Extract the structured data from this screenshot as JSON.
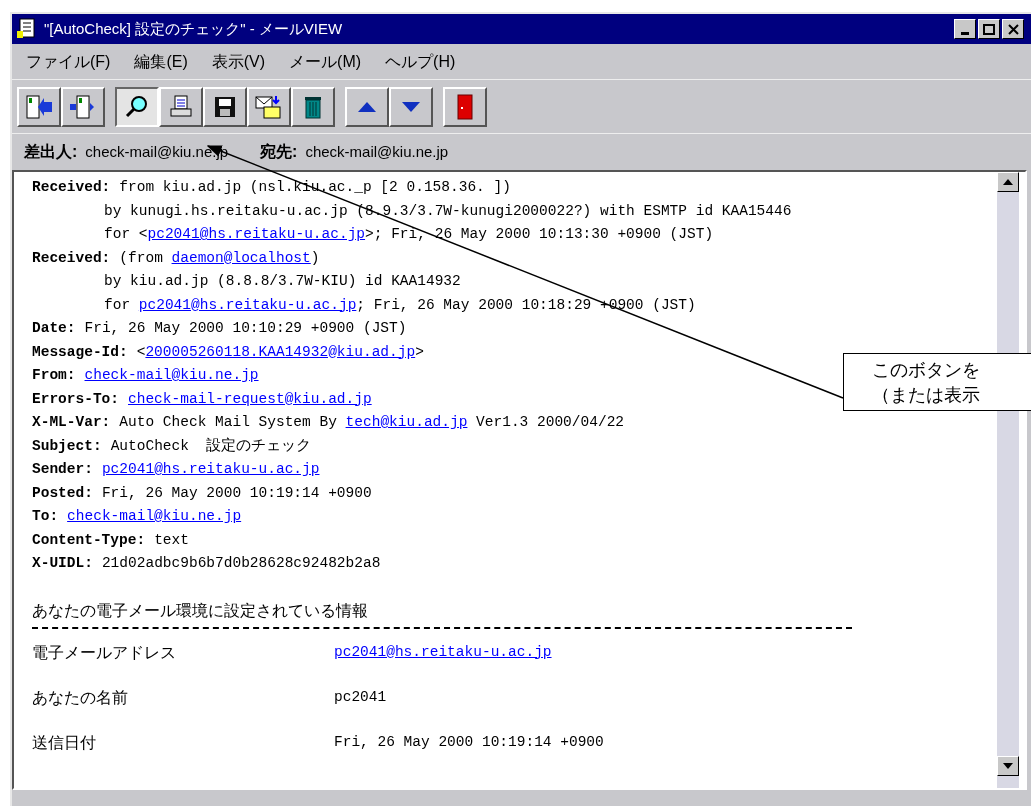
{
  "window": {
    "title": "\"[AutoCheck] 設定のチェック\" - メールVIEW"
  },
  "menu": [
    {
      "label": "ファイル(F)"
    },
    {
      "label": "編集(E)"
    },
    {
      "label": "表示(V)"
    },
    {
      "label": "メール(M)"
    },
    {
      "label": "ヘルプ(H)"
    }
  ],
  "toolbar": [
    [
      {
        "kind": "reply",
        "pressed": false
      },
      {
        "kind": "forward",
        "pressed": false
      }
    ],
    [
      {
        "kind": "search",
        "pressed": true
      },
      {
        "kind": "print",
        "pressed": false
      },
      {
        "kind": "save",
        "pressed": false
      },
      {
        "kind": "mailbox",
        "pressed": false
      },
      {
        "kind": "trash",
        "pressed": false
      }
    ],
    [
      {
        "kind": "up",
        "pressed": false
      },
      {
        "kind": "down",
        "pressed": false
      }
    ],
    [
      {
        "kind": "exit",
        "pressed": false
      }
    ]
  ],
  "address": [
    {
      "label": "差出人:",
      "value": "check-mail@kiu.ne.jp"
    },
    {
      "label": "宛先:",
      "value": "check-mail@kiu.ne.jp"
    }
  ],
  "headers": [
    {
      "label": "Received:",
      "lines": [
        [
          {
            "kind": "text",
            "text": "from kiu.ad.jp (nsl.kiu.ac._p [2 0.158.36. ])"
          }
        ],
        [
          {
            "kind": "text",
            "text": "by kunugi.hs.reitaku-u.ac.jp (8.9.3/3.7W-kunugi2000022?) with ESMTP id KAA15446"
          }
        ],
        [
          {
            "kind": "text",
            "text": "for <"
          },
          {
            "kind": "link",
            "text": "pc2041@hs.reitaku-u.ac.jp"
          },
          {
            "kind": "text",
            "text": ">; Fri, 26 May 2000 10:13:30 +0900 (JST)"
          }
        ]
      ]
    },
    {
      "label": "Received:",
      "lines": [
        [
          {
            "kind": "text",
            "text": "(from "
          },
          {
            "kind": "link",
            "text": "daemon@localhost"
          },
          {
            "kind": "text",
            "text": ")"
          }
        ],
        [
          {
            "kind": "text",
            "text": "by kiu.ad.jp (8.8.8/3.7W-KIU) id KAA14932"
          }
        ],
        [
          {
            "kind": "text",
            "text": "for "
          },
          {
            "kind": "link",
            "text": "pc2041@hs.reitaku-u.ac.jp"
          },
          {
            "kind": "text",
            "text": "; Fri, 26 May 2000 10:18:29 +0900 (JST)"
          }
        ]
      ]
    },
    {
      "label": "Date:",
      "lines": [
        [
          {
            "kind": "text",
            "text": "Fri, 26 May 2000 10:10:29 +0900 (JST)"
          }
        ]
      ]
    },
    {
      "label": "Message-Id:",
      "lines": [
        [
          {
            "kind": "text",
            "text": "<"
          },
          {
            "kind": "link",
            "text": "200005260118.KAA14932@kiu.ad.jp"
          },
          {
            "kind": "text",
            "text": ">"
          }
        ]
      ]
    },
    {
      "label": "From:",
      "lines": [
        [
          {
            "kind": "link",
            "text": "check-mail@kiu.ne.jp"
          }
        ]
      ]
    },
    {
      "label": "Errors-To:",
      "lines": [
        [
          {
            "kind": "link",
            "text": "check-mail-request@kiu.ad.jp"
          }
        ]
      ]
    },
    {
      "label": "X-ML-Var:",
      "lines": [
        [
          {
            "kind": "text",
            "text": "Auto Check Mail System By "
          },
          {
            "kind": "link",
            "text": "tech@kiu.ad.jp"
          },
          {
            "kind": "text",
            "text": " Ver1.3 2000/04/22"
          }
        ]
      ]
    },
    {
      "label": "Subject:",
      "lines": [
        [
          {
            "kind": "text",
            "text": "AutoCheck  設定のチェック"
          }
        ]
      ]
    },
    {
      "label": "Sender:",
      "lines": [
        [
          {
            "kind": "link",
            "text": "pc2041@hs.reitaku-u.ac.jp"
          }
        ]
      ]
    },
    {
      "label": "Posted:",
      "lines": [
        [
          {
            "kind": "text",
            "text": "Fri, 26 May 2000 10:19:14 +0900"
          }
        ]
      ]
    },
    {
      "label": "To:",
      "lines": [
        [
          {
            "kind": "link",
            "text": "check-mail@kiu.ne.jp"
          }
        ]
      ]
    },
    {
      "label": "Content-Type:",
      "lines": [
        [
          {
            "kind": "text",
            "text": "text"
          }
        ]
      ]
    },
    {
      "label": "X-UIDL:",
      "lines": [
        [
          {
            "kind": "text",
            "text": "21d02adbc9b6b7d0b28628c92482b2a8"
          }
        ]
      ]
    }
  ],
  "intro": "あなたの電子メール環境に設定されている情報",
  "info": [
    {
      "label": "電子メールアドレス",
      "value": "pc2041@hs.reitaku-u.ac.jp",
      "kind": "link"
    },
    {
      "label": "あなたの名前",
      "value": "pc2041",
      "kind": "text"
    },
    {
      "label": "送信日付",
      "value": "Fri, 26 May 2000 10:19:14 +0900",
      "kind": "text"
    }
  ],
  "callout": {
    "lines": [
      "このボタンを",
      "（または表示"
    ]
  }
}
